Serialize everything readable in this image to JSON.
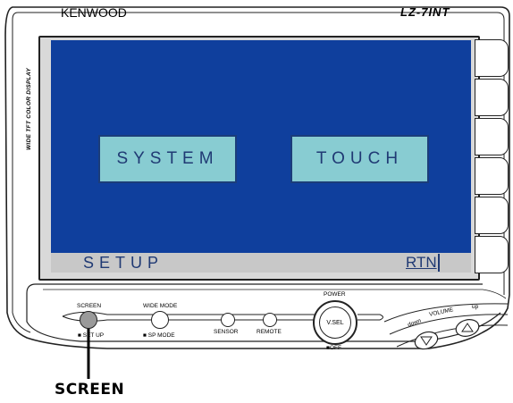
{
  "device": {
    "brand": "KENWOOD",
    "model": "LZ-7INT",
    "side_label": "WIDE TFT COLOR DISPLAY"
  },
  "screen": {
    "buttons": [
      {
        "label": "SYSTEM"
      },
      {
        "label": "TOUCH"
      }
    ],
    "bar_title": "SETUP",
    "return_label": "RTN"
  },
  "controls": {
    "screen_label": "SCREEN",
    "screen_sub": "SET UP",
    "wide_mode_label": "WIDE MODE",
    "wide_mode_sub": "SP MODE",
    "sensor_label": "SENSOR",
    "remote_label": "REMOTE",
    "power_label": "POWER",
    "vsel_label": "V.SEL",
    "off_label": "OFF",
    "volume_label": "VOLUME",
    "volume_down": "down",
    "volume_up": "up"
  },
  "callout": {
    "label": "SCREEN"
  }
}
